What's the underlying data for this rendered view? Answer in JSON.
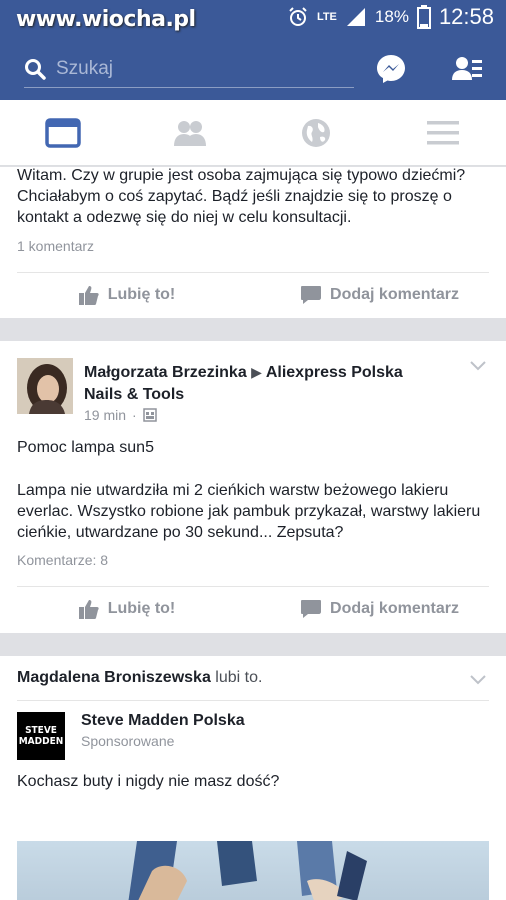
{
  "status_bar": {
    "watermark": "www.wiocha.pl",
    "network": "LTE",
    "battery": "18%",
    "time": "12:58"
  },
  "search": {
    "placeholder": "Szukaj"
  },
  "tabs": [
    "news-feed",
    "friends",
    "globe",
    "menu"
  ],
  "post1": {
    "text": "Witam. Czy w grupie jest osoba zajmująca się typowo dziećmi? Chciałabym o coś zapytać. Bądź jeśli znajdzie się to proszę o kontakt a odezwę się do niej w celu konsultacji.",
    "comments": "1 komentarz",
    "like_label": "Lubię to!",
    "comment_label": "Dodaj komentarz"
  },
  "post2": {
    "author": "Małgorzata Brzezinka",
    "group": "Aliexpress Polska Nails & Tools",
    "time": "19 min",
    "title": "Pomoc lampa sun5",
    "text": "Lampa nie utwardziła mi 2 cieńkich warstw beżowego lakieru everlac. Wszystko robione jak pambuk przykazał, warstwy lakieru cieńkie, utwardzane po 30 sekund... Zepsuta?",
    "comments": "Komentarze: 8",
    "like_label": "Lubię to!",
    "comment_label": "Dodaj komentarz"
  },
  "post3": {
    "liker": "Magdalena Broniszewska",
    "liker_suffix": "lubi to.",
    "page": "Steve Madden Polska",
    "sponsored": "Sponsorowane",
    "logo_text_1": "STEVE",
    "logo_text_2": "MADDEN",
    "text": "Kochasz buty i nigdy nie masz dość?"
  },
  "colors": {
    "fb_blue": "#3b5998",
    "active_tab": "#4267b2",
    "inactive_tab": "#c9ccd1",
    "grey_text": "#90949c"
  }
}
